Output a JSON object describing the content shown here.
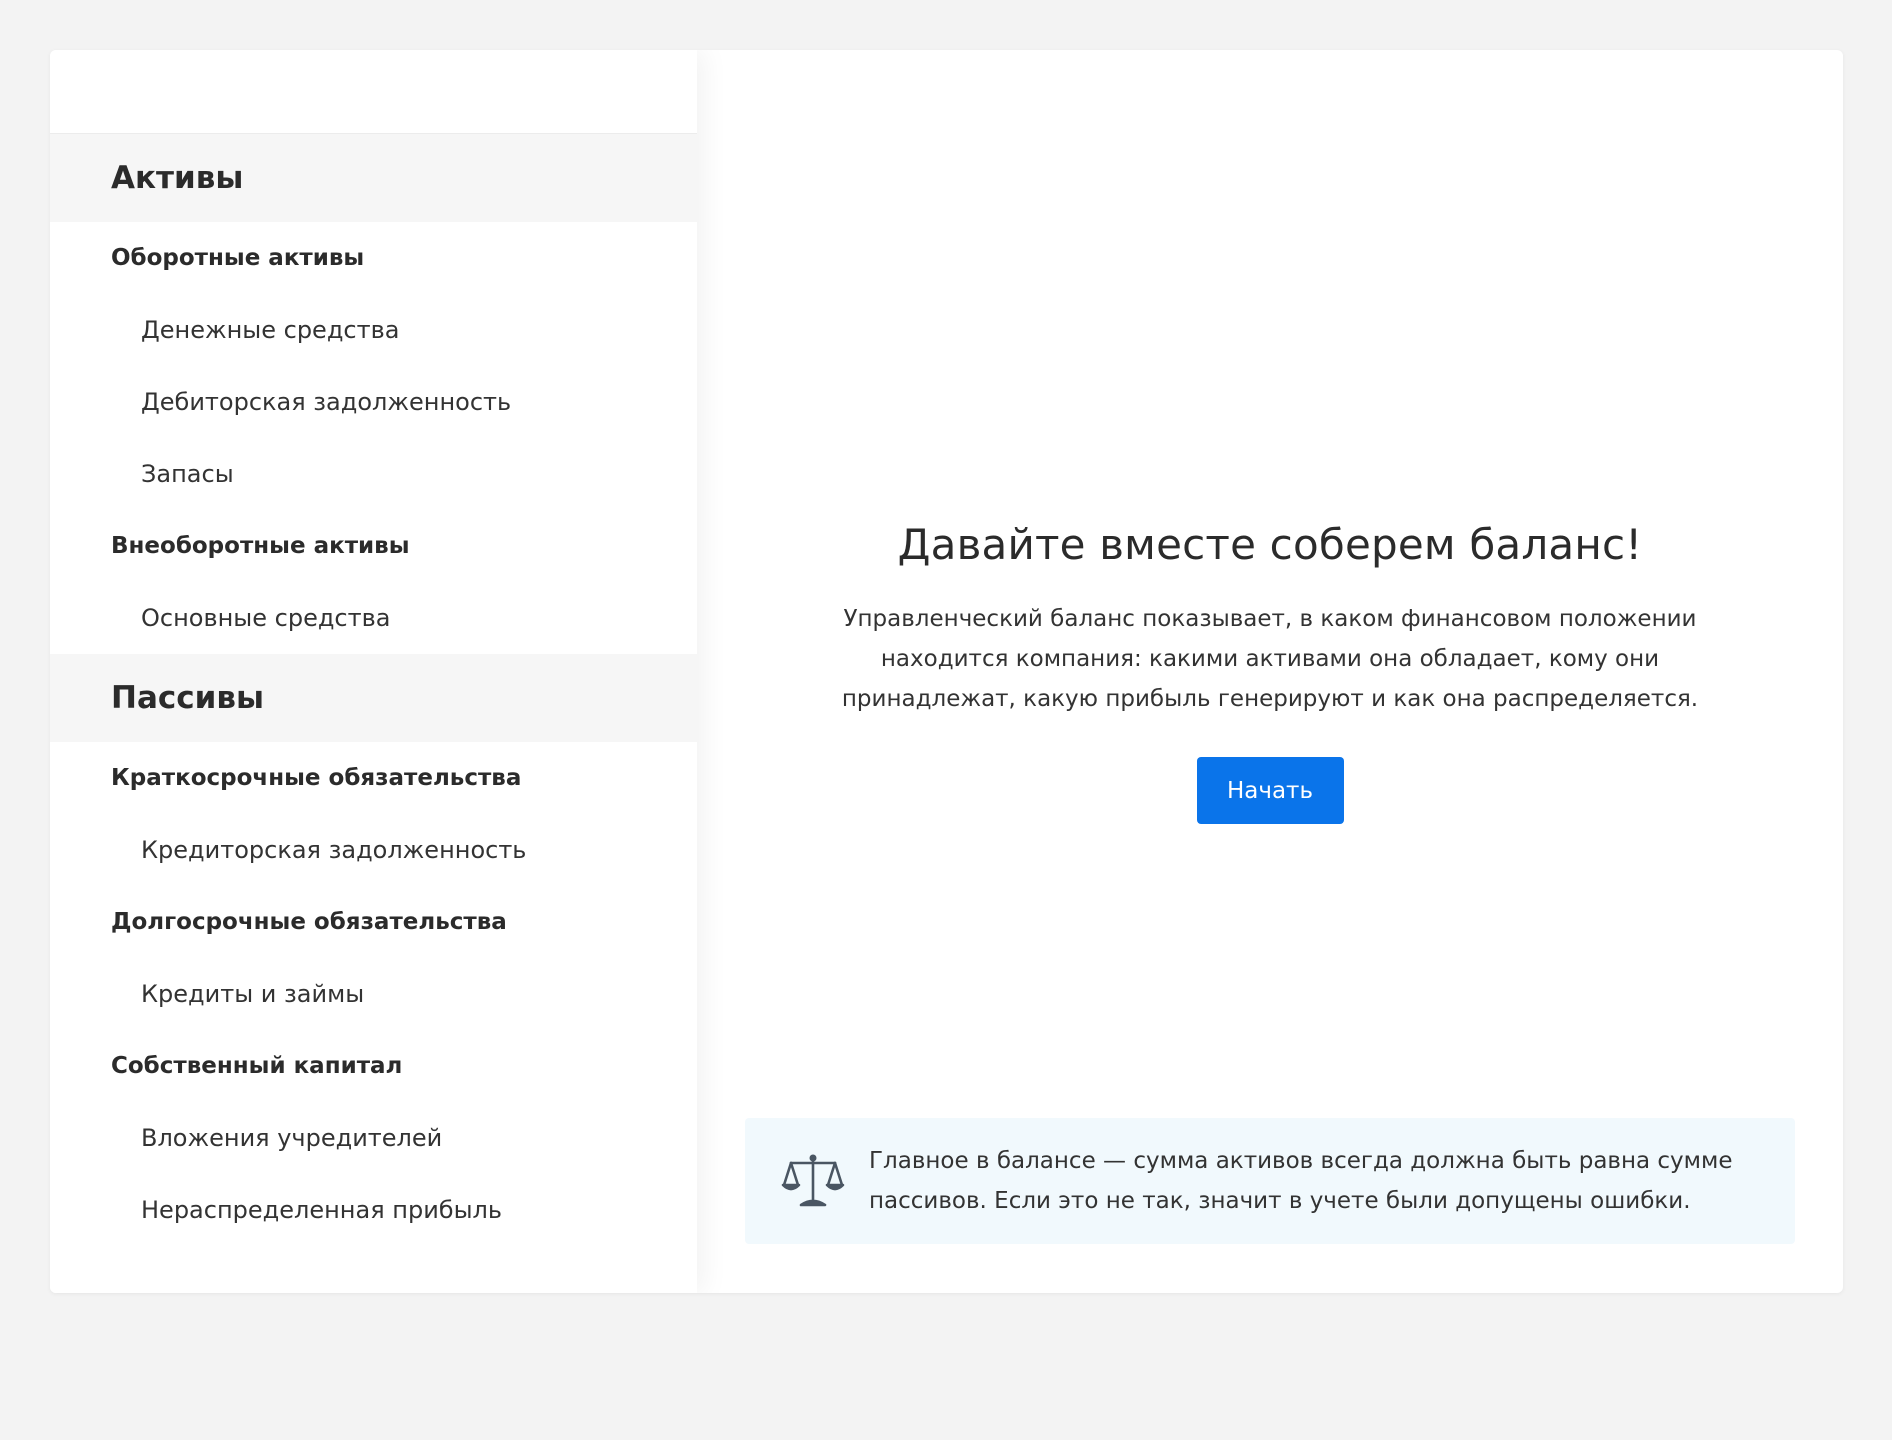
{
  "sidebar": {
    "sections": [
      {
        "title": "Активы",
        "groups": [
          {
            "title": "Оборотные активы",
            "items": [
              "Денежные средства",
              "Дебиторская задолженность",
              "Запасы"
            ]
          },
          {
            "title": "Внеоборотные активы",
            "items": [
              "Основные средства"
            ]
          }
        ]
      },
      {
        "title": "Пассивы",
        "groups": [
          {
            "title": "Краткосрочные обязательства",
            "items": [
              "Кредиторская задолженность"
            ]
          },
          {
            "title": "Долгосрочные обязательства",
            "items": [
              "Кредиты и займы"
            ]
          },
          {
            "title": "Собственный капитал",
            "items": [
              "Вложения учредителей",
              "Нераспределенная прибыль"
            ]
          }
        ]
      }
    ]
  },
  "main": {
    "title": "Давайте вместе соберем баланс!",
    "description": "Управленческий баланс показывает, в каком финансовом положении находится компания: какими активами она обладает, кому они принадлежат, какую прибыль генерируют и как она распределяется.",
    "start_label": "Начать",
    "note_icon": "scales-icon",
    "note": "Главное в балансе — сумма активов всегда должна быть равна сумме пассивов. Если это не так, значит в учете были допущены ошибки."
  },
  "colors": {
    "accent": "#0a74ea",
    "background": "#f3f3f3",
    "section_bg": "#f6f6f6",
    "note_bg": "#f1f9fd"
  }
}
